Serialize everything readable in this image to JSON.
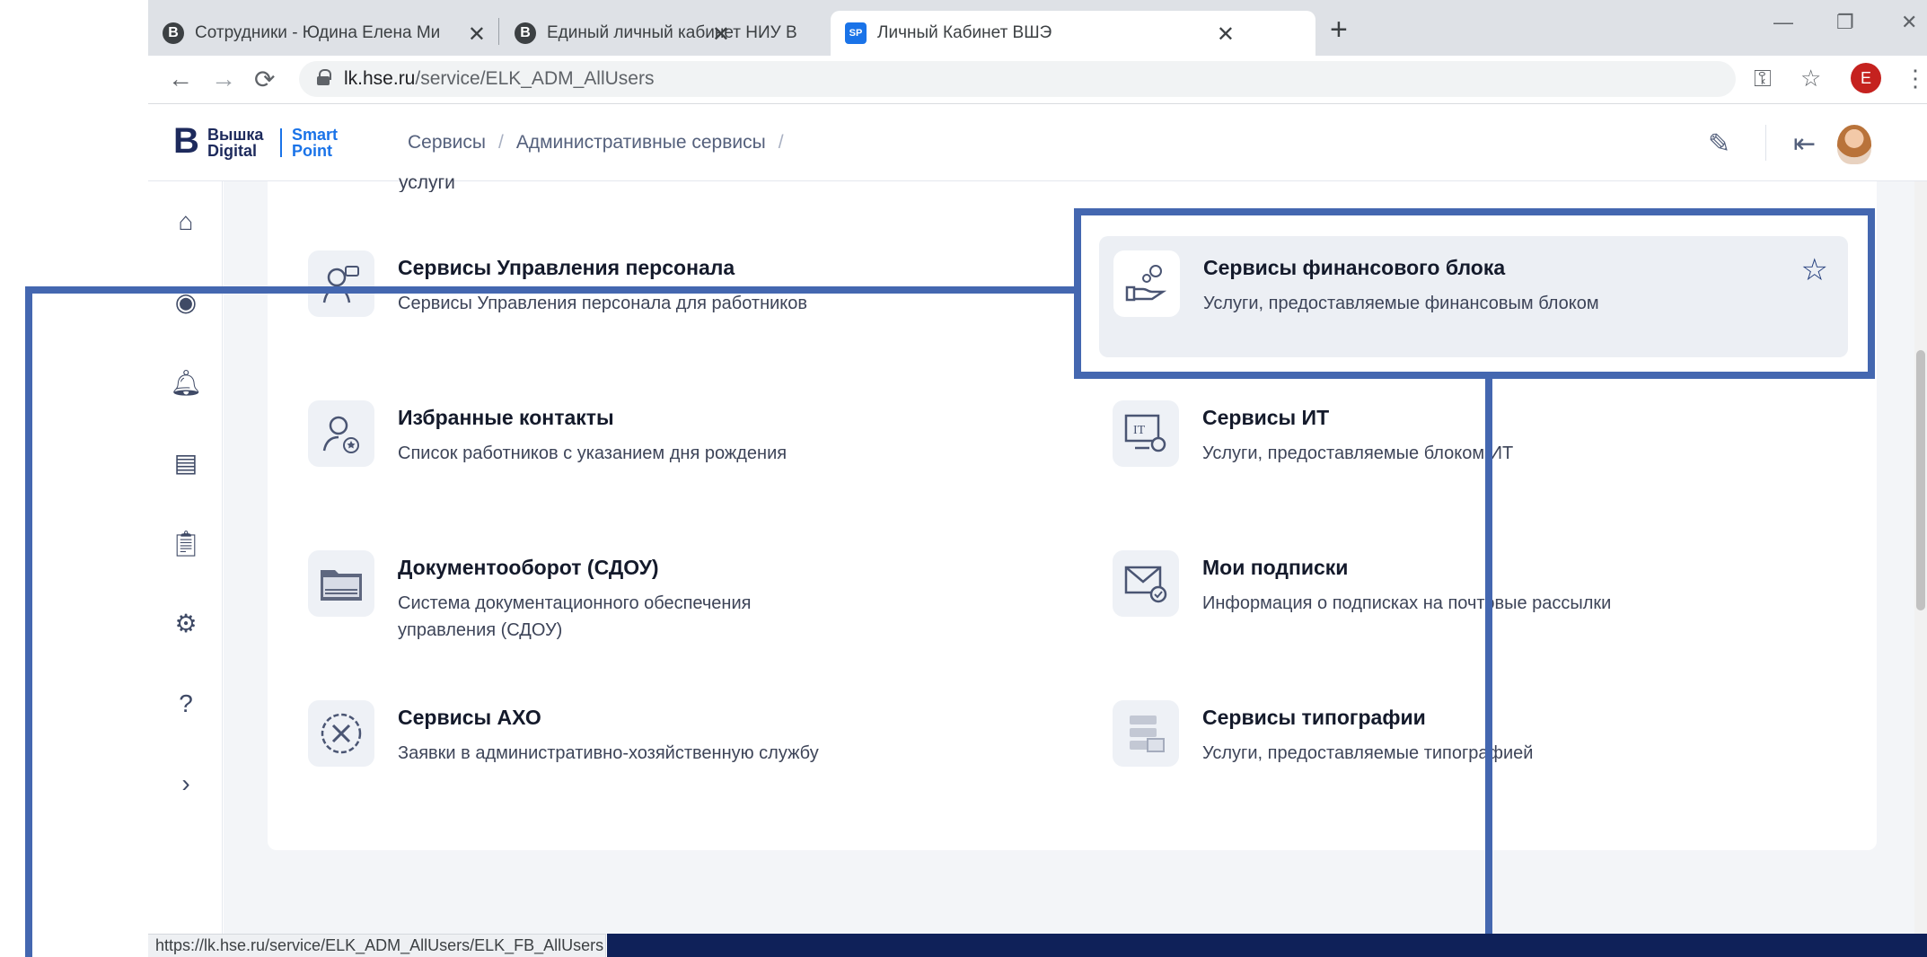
{
  "browser": {
    "tabs": [
      {
        "title": "Сотрудники - Юдина Елена Ми"
      },
      {
        "title": "Единый личный кабинет НИУ В"
      },
      {
        "title": "Личный Кабинет ВШЭ"
      }
    ],
    "url_host": "lk.hse.ru",
    "url_path": "/service/ELK_ADM_AllUsers",
    "profile_initial": "E"
  },
  "header": {
    "logo_line1": "Вышка",
    "logo_line2": "Digital",
    "logo_line3": "Smart",
    "logo_line4": "Point",
    "breadcrumbs": [
      "Сервисы",
      "Административные сервисы"
    ]
  },
  "partial_text": "услуги",
  "services": [
    {
      "title": "Сервисы Управления персонала",
      "desc": "Сервисы Управления персонала для работников",
      "icon": "hr-icon"
    },
    {
      "title": "Сервисы финансового блока",
      "desc": "Услуги, предоставляемые финансовым блоком",
      "icon": "finance-icon"
    },
    {
      "title": "Избранные контакты",
      "desc": "Список работников с указанием дня рождения",
      "icon": "contacts-icon"
    },
    {
      "title": "Сервисы ИТ",
      "desc": "Услуги, предоставляемые блоком ИТ",
      "icon": "it-icon"
    },
    {
      "title": "Документооборот (СДОУ)",
      "desc": "Система документационного обеспечения управления (СДОУ)",
      "icon": "folder-icon"
    },
    {
      "title": "Мои подписки",
      "desc": "Информация о подписках на почтовые рассылки",
      "icon": "mail-icon"
    },
    {
      "title": "Сервисы АХО",
      "desc": "Заявки в административно-хозяйственную службу",
      "icon": "tools-icon"
    },
    {
      "title": "Сервисы типографии",
      "desc": "Услуги, предоставляемые типографией",
      "icon": "print-icon"
    }
  ],
  "status_url": "https://lk.hse.ru/service/ELK_ADM_AllUsers/ELK_FB_AllUsers",
  "colors": {
    "brand": "#1d2a5c",
    "accent": "#1a73e8",
    "annotation": "#4467b0",
    "footer": "#0f2159"
  }
}
